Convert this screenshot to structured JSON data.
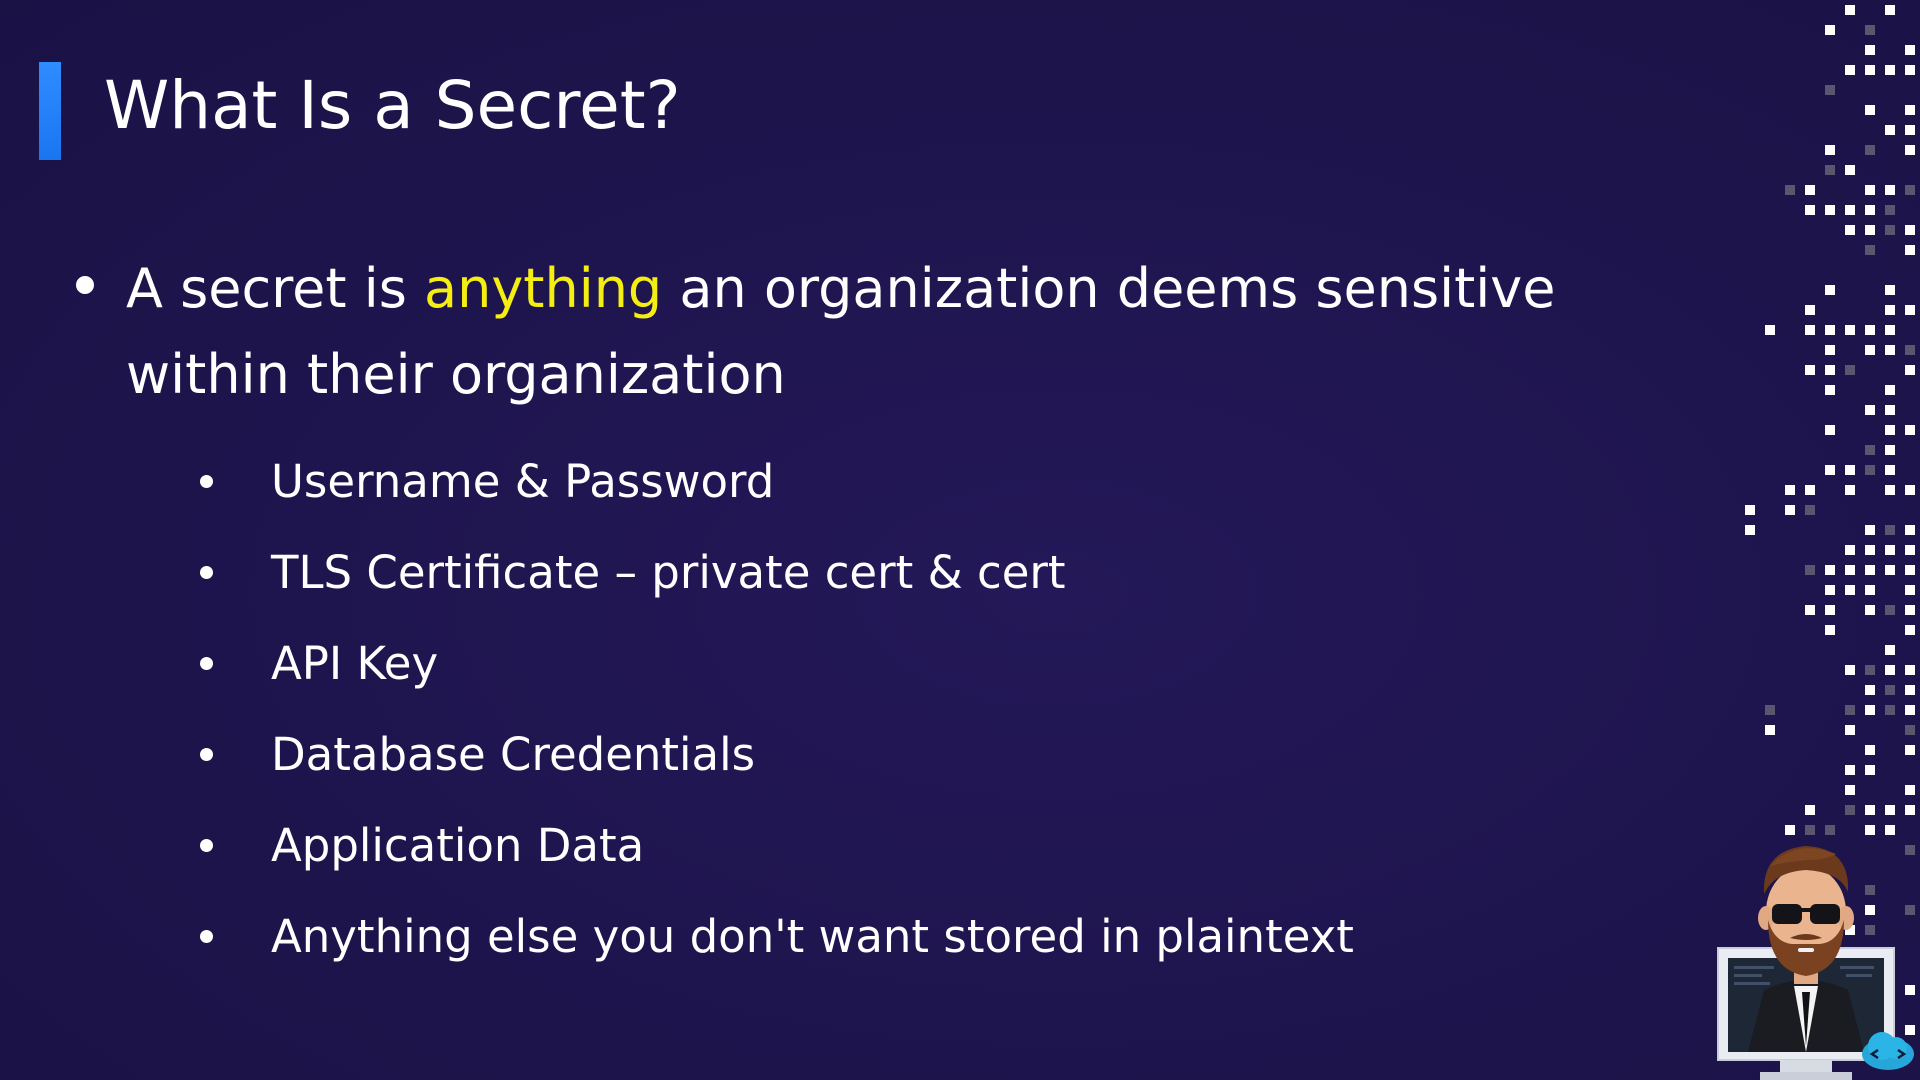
{
  "slide": {
    "title": "What Is a Secret?",
    "main_bullet": {
      "before": "A secret is ",
      "highlight": "anything",
      "after": " an organization deems sensitive within their organization"
    },
    "sub_bullets": [
      "Username & Password",
      "TLS Certificate – private cert & cert",
      "API Key",
      "Database Credentials",
      "Application Data",
      "Anything else you don't want stored in plaintext"
    ]
  },
  "colors": {
    "background": "#1f154f",
    "accent_bar": "#1976f0",
    "highlight": "#f5ee12",
    "text": "#ffffff"
  },
  "icons": {
    "decoration": "pixel-dots-decoration",
    "mascot": "presenter-mascot-icon",
    "logo": "cloud-code-logo-icon"
  }
}
